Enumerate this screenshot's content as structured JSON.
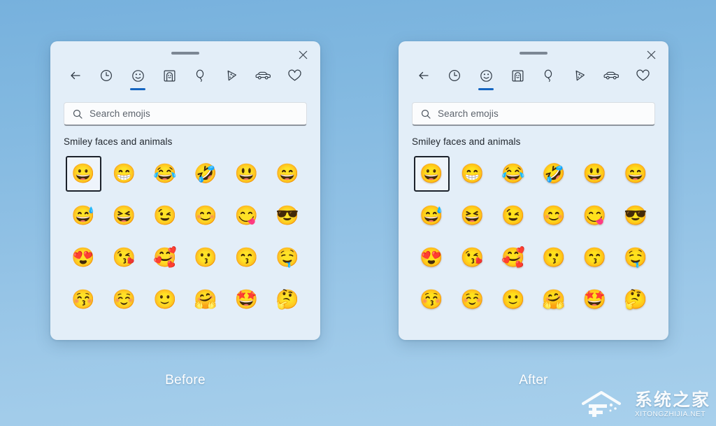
{
  "background": {
    "gradient_top": "#77b1dd",
    "gradient_bottom": "#a8d0ec"
  },
  "panels": [
    {
      "id": "before",
      "caption": "Before",
      "close_label": "✕",
      "drag_handle_name": "drag-handle",
      "search": {
        "placeholder": "Search emojis",
        "icon": "search-icon"
      },
      "section_title": "Smiley faces and animals",
      "tabs": [
        {
          "name": "back",
          "icon": "back-arrow-icon",
          "active": false
        },
        {
          "name": "recent",
          "icon": "clock-icon",
          "active": false
        },
        {
          "name": "emoji",
          "icon": "smiley-face-icon",
          "active": true
        },
        {
          "name": "gifs",
          "icon": "person-portrait-icon",
          "active": false
        },
        {
          "name": "celebration",
          "icon": "balloon-icon",
          "active": false
        },
        {
          "name": "food",
          "icon": "pizza-icon",
          "active": false
        },
        {
          "name": "travel",
          "icon": "car-icon",
          "active": false
        },
        {
          "name": "symbols",
          "icon": "heart-icon",
          "active": false
        }
      ],
      "emojis": [
        {
          "char": "😀",
          "name": "grinning-face",
          "selected": true
        },
        {
          "char": "😁",
          "name": "beaming-face-with-smiling-eyes",
          "selected": false
        },
        {
          "char": "😂",
          "name": "face-with-tears-of-joy",
          "selected": false
        },
        {
          "char": "🤣",
          "name": "rolling-on-the-floor-laughing",
          "selected": false
        },
        {
          "char": "😃",
          "name": "grinning-face-with-big-eyes",
          "selected": false
        },
        {
          "char": "😄",
          "name": "grinning-face-with-smiling-eyes",
          "selected": false
        },
        {
          "char": "😅",
          "name": "grinning-face-with-sweat",
          "selected": false
        },
        {
          "char": "😆",
          "name": "grinning-squinting-face",
          "selected": false
        },
        {
          "char": "😉",
          "name": "winking-face",
          "selected": false
        },
        {
          "char": "😊",
          "name": "smiling-face-with-smiling-eyes",
          "selected": false
        },
        {
          "char": "😋",
          "name": "face-savoring-food",
          "selected": false
        },
        {
          "char": "😎",
          "name": "smiling-face-with-sunglasses",
          "selected": false
        },
        {
          "char": "😍",
          "name": "smiling-face-with-heart-eyes",
          "selected": false
        },
        {
          "char": "😘",
          "name": "face-blowing-a-kiss",
          "selected": false
        },
        {
          "char": "🥰",
          "name": "smiling-face-with-hearts",
          "selected": false
        },
        {
          "char": "😗",
          "name": "kissing-face",
          "selected": false
        },
        {
          "char": "😙",
          "name": "kissing-face-with-smiling-eyes",
          "selected": false
        },
        {
          "char": "🤤",
          "name": "drooling-face",
          "selected": false
        },
        {
          "char": "😚",
          "name": "kissing-face-with-closed-eyes",
          "selected": false
        },
        {
          "char": "☺️",
          "name": "smiling-face",
          "selected": false
        },
        {
          "char": "🙂",
          "name": "slightly-smiling-face",
          "selected": false
        },
        {
          "char": "🤗",
          "name": "hugging-face",
          "selected": false
        },
        {
          "char": "🤩",
          "name": "star-struck",
          "selected": false
        },
        {
          "char": "🤔",
          "name": "thinking-face",
          "selected": false
        }
      ]
    },
    {
      "id": "after",
      "caption": "After",
      "close_label": "✕",
      "drag_handle_name": "drag-handle",
      "search": {
        "placeholder": "Search emojis",
        "icon": "search-icon"
      },
      "section_title": "Smiley faces and animals",
      "tabs": [
        {
          "name": "back",
          "icon": "back-arrow-icon",
          "active": false
        },
        {
          "name": "recent",
          "icon": "clock-icon",
          "active": false
        },
        {
          "name": "emoji",
          "icon": "smiley-face-icon",
          "active": true
        },
        {
          "name": "gifs",
          "icon": "person-portrait-icon",
          "active": false
        },
        {
          "name": "celebration",
          "icon": "balloon-icon",
          "active": false
        },
        {
          "name": "food",
          "icon": "pizza-icon",
          "active": false
        },
        {
          "name": "travel",
          "icon": "car-icon",
          "active": false
        },
        {
          "name": "symbols",
          "icon": "heart-icon",
          "active": false
        }
      ],
      "emojis": [
        {
          "char": "😀",
          "name": "grinning-face",
          "selected": true
        },
        {
          "char": "😁",
          "name": "beaming-face-with-smiling-eyes",
          "selected": false
        },
        {
          "char": "😂",
          "name": "face-with-tears-of-joy",
          "selected": false
        },
        {
          "char": "🤣",
          "name": "rolling-on-the-floor-laughing",
          "selected": false
        },
        {
          "char": "😃",
          "name": "grinning-face-with-big-eyes",
          "selected": false
        },
        {
          "char": "😄",
          "name": "grinning-face-with-smiling-eyes",
          "selected": false
        },
        {
          "char": "😅",
          "name": "grinning-face-with-sweat",
          "selected": false
        },
        {
          "char": "😆",
          "name": "grinning-squinting-face",
          "selected": false
        },
        {
          "char": "😉",
          "name": "winking-face",
          "selected": false
        },
        {
          "char": "😊",
          "name": "smiling-face-with-smiling-eyes",
          "selected": false
        },
        {
          "char": "😋",
          "name": "face-savoring-food",
          "selected": false
        },
        {
          "char": "😎",
          "name": "smiling-face-with-sunglasses",
          "selected": false
        },
        {
          "char": "😍",
          "name": "smiling-face-with-heart-eyes",
          "selected": false
        },
        {
          "char": "😘",
          "name": "face-blowing-a-kiss",
          "selected": false
        },
        {
          "char": "🥰",
          "name": "smiling-face-with-hearts",
          "selected": false
        },
        {
          "char": "😗",
          "name": "kissing-face",
          "selected": false
        },
        {
          "char": "😙",
          "name": "kissing-face-with-smiling-eyes",
          "selected": false
        },
        {
          "char": "🤤",
          "name": "drooling-face",
          "selected": false
        },
        {
          "char": "😚",
          "name": "kissing-face-with-closed-eyes",
          "selected": false
        },
        {
          "char": "☺️",
          "name": "smiling-face",
          "selected": false
        },
        {
          "char": "🙂",
          "name": "slightly-smiling-face",
          "selected": false
        },
        {
          "char": "🤗",
          "name": "hugging-face",
          "selected": false
        },
        {
          "char": "🤩",
          "name": "star-struck",
          "selected": false
        },
        {
          "char": "🤔",
          "name": "thinking-face",
          "selected": false
        }
      ]
    }
  ],
  "watermark": {
    "chinese": "系统之家",
    "latin": "XITONGZHIJIA.NET"
  }
}
